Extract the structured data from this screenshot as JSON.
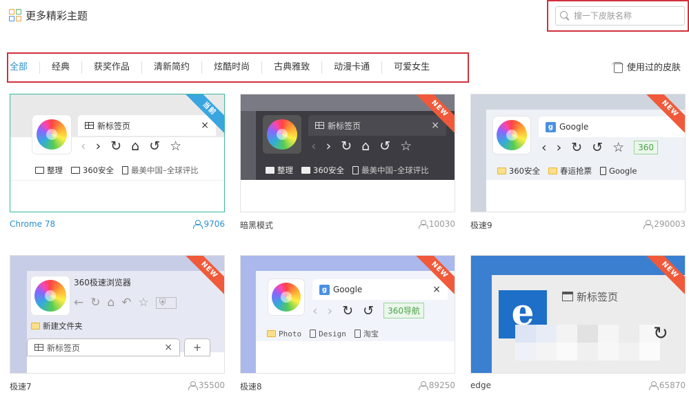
{
  "header": {
    "title": "更多精彩主题",
    "search_placeholder": "搜一下皮肤名称"
  },
  "categories": {
    "active_color": "#2a8fcf",
    "items": [
      {
        "label": "全部",
        "active": true
      },
      {
        "label": "经典"
      },
      {
        "label": "获奖作品"
      },
      {
        "label": "清新简约"
      },
      {
        "label": "炫酷时尚"
      },
      {
        "label": "古典雅致"
      },
      {
        "label": "动漫卡通"
      },
      {
        "label": "可爱女生"
      }
    ]
  },
  "used_skins_label": "使用过的皮肤",
  "skins": [
    {
      "name": "Chrome 78",
      "count": "9706",
      "badge": "当前",
      "badge_color": "#3aa6e0",
      "selected": true,
      "preview": {
        "tab_title": "新标签页",
        "close": "×",
        "nav": [
          "‹",
          "›",
          "↻",
          "⌂",
          "↺",
          "☆"
        ],
        "bookmarks": [
          "整理",
          "360安全",
          "最美中国–全球评比"
        ]
      }
    },
    {
      "name": "暗黑模式",
      "count": "10030",
      "badge": "NEW",
      "badge_color": "#f05a3a",
      "preview": {
        "tab_title": "新标签页",
        "close": "×",
        "nav": [
          "‹",
          "›",
          "↻",
          "⌂",
          "↺",
          "☆"
        ],
        "bookmarks": [
          "整理",
          "360安全",
          "最美中国–全球评比"
        ]
      }
    },
    {
      "name": "极速9",
      "count": "290003",
      "badge": "NEW",
      "badge_color": "#f05a3a",
      "preview": {
        "tab_title": "Google",
        "g": "g",
        "nav": [
          "‹",
          "›",
          "↻",
          "↺",
          "☆"
        ],
        "tag": "360",
        "bookmarks": [
          "360安全",
          "春运抢票",
          "Google"
        ]
      }
    },
    {
      "name": "极速7",
      "count": "35500",
      "badge": "NEW",
      "badge_color": "#f05a3a",
      "preview": {
        "app_title": "360极速浏览器",
        "nav": [
          "←",
          "↻",
          "⌂",
          "↶",
          "☆",
          "⛨"
        ],
        "folder": "新建文件夹",
        "tab_title": "新标签页",
        "close": "×",
        "plus": "+"
      }
    },
    {
      "name": "极速8",
      "count": "89250",
      "badge": "NEW",
      "badge_color": "#f05a3a",
      "preview": {
        "tab_title": "Google",
        "g": "g",
        "close": "×",
        "nav": [
          "‹",
          "›",
          "↻",
          "↺"
        ],
        "tag": "360导航",
        "bookmarks": [
          "Photo",
          "Design",
          "淘宝"
        ]
      }
    },
    {
      "name": "edge",
      "count": "65870",
      "badge": "NEW",
      "badge_color": "#f05a3a",
      "preview": {
        "tab_title": "新标签页",
        "ie_letter": "e",
        "refresh": "↻"
      }
    }
  ]
}
